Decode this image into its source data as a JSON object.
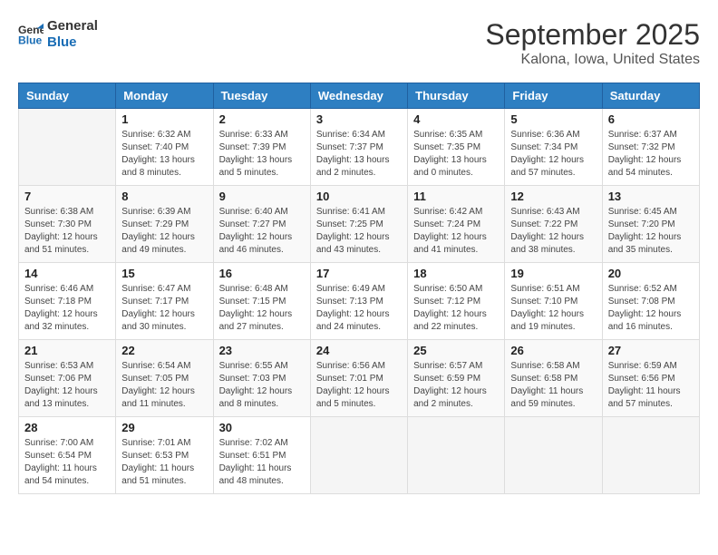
{
  "header": {
    "logo_line1": "General",
    "logo_line2": "Blue",
    "month": "September 2025",
    "location": "Kalona, Iowa, United States"
  },
  "days_of_week": [
    "Sunday",
    "Monday",
    "Tuesday",
    "Wednesday",
    "Thursday",
    "Friday",
    "Saturday"
  ],
  "weeks": [
    [
      {
        "day": "",
        "sunrise": "",
        "sunset": "",
        "daylight": ""
      },
      {
        "day": "1",
        "sunrise": "6:32 AM",
        "sunset": "7:40 PM",
        "daylight": "13 hours and 8 minutes."
      },
      {
        "day": "2",
        "sunrise": "6:33 AM",
        "sunset": "7:39 PM",
        "daylight": "13 hours and 5 minutes."
      },
      {
        "day": "3",
        "sunrise": "6:34 AM",
        "sunset": "7:37 PM",
        "daylight": "13 hours and 2 minutes."
      },
      {
        "day": "4",
        "sunrise": "6:35 AM",
        "sunset": "7:35 PM",
        "daylight": "13 hours and 0 minutes."
      },
      {
        "day": "5",
        "sunrise": "6:36 AM",
        "sunset": "7:34 PM",
        "daylight": "12 hours and 57 minutes."
      },
      {
        "day": "6",
        "sunrise": "6:37 AM",
        "sunset": "7:32 PM",
        "daylight": "12 hours and 54 minutes."
      }
    ],
    [
      {
        "day": "7",
        "sunrise": "6:38 AM",
        "sunset": "7:30 PM",
        "daylight": "12 hours and 51 minutes."
      },
      {
        "day": "8",
        "sunrise": "6:39 AM",
        "sunset": "7:29 PM",
        "daylight": "12 hours and 49 minutes."
      },
      {
        "day": "9",
        "sunrise": "6:40 AM",
        "sunset": "7:27 PM",
        "daylight": "12 hours and 46 minutes."
      },
      {
        "day": "10",
        "sunrise": "6:41 AM",
        "sunset": "7:25 PM",
        "daylight": "12 hours and 43 minutes."
      },
      {
        "day": "11",
        "sunrise": "6:42 AM",
        "sunset": "7:24 PM",
        "daylight": "12 hours and 41 minutes."
      },
      {
        "day": "12",
        "sunrise": "6:43 AM",
        "sunset": "7:22 PM",
        "daylight": "12 hours and 38 minutes."
      },
      {
        "day": "13",
        "sunrise": "6:45 AM",
        "sunset": "7:20 PM",
        "daylight": "12 hours and 35 minutes."
      }
    ],
    [
      {
        "day": "14",
        "sunrise": "6:46 AM",
        "sunset": "7:18 PM",
        "daylight": "12 hours and 32 minutes."
      },
      {
        "day": "15",
        "sunrise": "6:47 AM",
        "sunset": "7:17 PM",
        "daylight": "12 hours and 30 minutes."
      },
      {
        "day": "16",
        "sunrise": "6:48 AM",
        "sunset": "7:15 PM",
        "daylight": "12 hours and 27 minutes."
      },
      {
        "day": "17",
        "sunrise": "6:49 AM",
        "sunset": "7:13 PM",
        "daylight": "12 hours and 24 minutes."
      },
      {
        "day": "18",
        "sunrise": "6:50 AM",
        "sunset": "7:12 PM",
        "daylight": "12 hours and 22 minutes."
      },
      {
        "day": "19",
        "sunrise": "6:51 AM",
        "sunset": "7:10 PM",
        "daylight": "12 hours and 19 minutes."
      },
      {
        "day": "20",
        "sunrise": "6:52 AM",
        "sunset": "7:08 PM",
        "daylight": "12 hours and 16 minutes."
      }
    ],
    [
      {
        "day": "21",
        "sunrise": "6:53 AM",
        "sunset": "7:06 PM",
        "daylight": "12 hours and 13 minutes."
      },
      {
        "day": "22",
        "sunrise": "6:54 AM",
        "sunset": "7:05 PM",
        "daylight": "12 hours and 11 minutes."
      },
      {
        "day": "23",
        "sunrise": "6:55 AM",
        "sunset": "7:03 PM",
        "daylight": "12 hours and 8 minutes."
      },
      {
        "day": "24",
        "sunrise": "6:56 AM",
        "sunset": "7:01 PM",
        "daylight": "12 hours and 5 minutes."
      },
      {
        "day": "25",
        "sunrise": "6:57 AM",
        "sunset": "6:59 PM",
        "daylight": "12 hours and 2 minutes."
      },
      {
        "day": "26",
        "sunrise": "6:58 AM",
        "sunset": "6:58 PM",
        "daylight": "11 hours and 59 minutes."
      },
      {
        "day": "27",
        "sunrise": "6:59 AM",
        "sunset": "6:56 PM",
        "daylight": "11 hours and 57 minutes."
      }
    ],
    [
      {
        "day": "28",
        "sunrise": "7:00 AM",
        "sunset": "6:54 PM",
        "daylight": "11 hours and 54 minutes."
      },
      {
        "day": "29",
        "sunrise": "7:01 AM",
        "sunset": "6:53 PM",
        "daylight": "11 hours and 51 minutes."
      },
      {
        "day": "30",
        "sunrise": "7:02 AM",
        "sunset": "6:51 PM",
        "daylight": "11 hours and 48 minutes."
      },
      {
        "day": "",
        "sunrise": "",
        "sunset": "",
        "daylight": ""
      },
      {
        "day": "",
        "sunrise": "",
        "sunset": "",
        "daylight": ""
      },
      {
        "day": "",
        "sunrise": "",
        "sunset": "",
        "daylight": ""
      },
      {
        "day": "",
        "sunrise": "",
        "sunset": "",
        "daylight": ""
      }
    ]
  ],
  "labels": {
    "sunrise_prefix": "Sunrise: ",
    "sunset_prefix": "Sunset: ",
    "daylight_prefix": "Daylight: "
  }
}
